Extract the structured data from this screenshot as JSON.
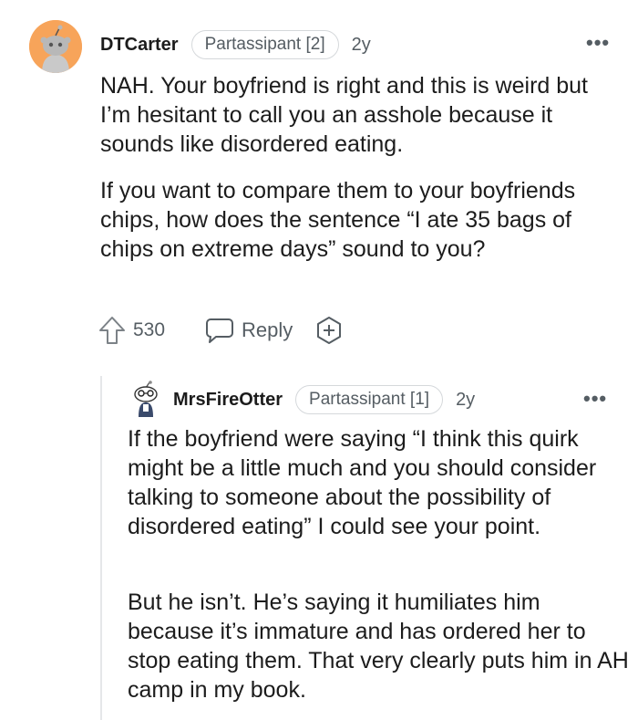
{
  "comments": [
    {
      "username": "DTCarter",
      "flair": "Partassipant [2]",
      "age": "2y",
      "more": "•••",
      "paragraphs": [
        "NAH. Your boyfriend is right and this is weird but I’m hesitant to call you an asshole because it sounds like disordered eating.",
        "If you want to compare them to your boyfriends chips, how does the sentence “I ate 35 bags of chips on extreme days” sound to you?"
      ],
      "votes": "530",
      "reply_label": "Reply",
      "avatar_color": "#f7a45a"
    },
    {
      "username": "MrsFireOtter",
      "flair": "Partassipant [1]",
      "age": "2y",
      "more": "•••",
      "paragraphs": [
        "If the boyfriend were saying “I think this quirk might be a little much and you should consider talking to someone about the possibility of disordered eating” I could see your point.",
        "But he isn’t. He’s saying it humiliates him because it’s immature and has ordered her to stop eating them. That very clearly puts him in AH camp in my book."
      ]
    }
  ],
  "icons": {
    "upvote": "upvote-arrow-icon",
    "reply": "speech-bubble-icon",
    "award": "plus-circle-icon",
    "more": "ellipsis-icon"
  }
}
